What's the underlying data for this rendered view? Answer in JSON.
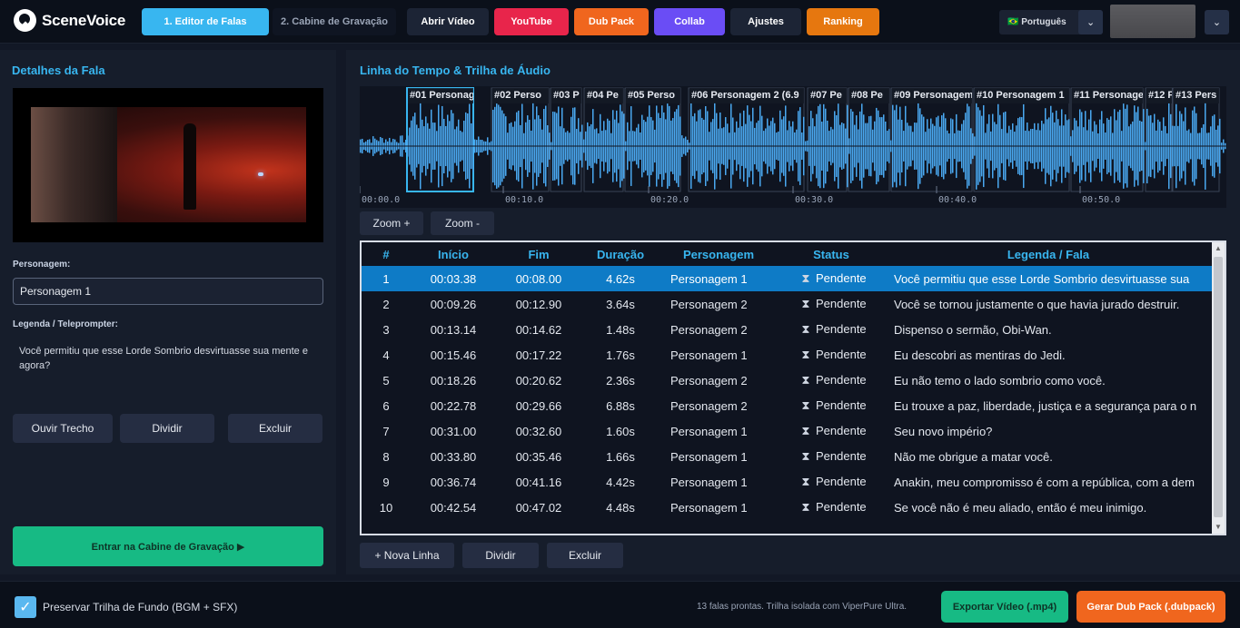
{
  "app": {
    "name": "SceneVoice"
  },
  "nav": {
    "editor": "1. Editor de Falas",
    "booth": "2. Cabine de Gravação",
    "open_video": "Abrir Vídeo",
    "youtube": "YouTube",
    "dubpack": "Dub Pack",
    "collab": "Collab",
    "settings": "Ajustes",
    "ranking": "Ranking",
    "language": "🇧🇷 Português"
  },
  "left": {
    "title": "Detalhes da Fala",
    "character_label": "Personagem:",
    "character_value": "Personagem 1",
    "legend_label": "Legenda / Teleprompter:",
    "legend_value": "Você permitiu que esse Lorde Sombrio desvirtuasse sua mente e agora?",
    "listen": "Ouvir Trecho",
    "split": "Dividir",
    "delete": "Excluir",
    "enter_booth": "Entrar na Cabine de Gravação ▶"
  },
  "timeline": {
    "title": "Linha do Tempo & Trilha de Áudio",
    "segment_labels": [
      "#01 Personagem 1",
      "#02 Perso",
      "#03 P",
      "#04 Pe",
      "#05 Perso",
      "#06 Personagem 2 (6.9",
      "#07 Pe",
      "#08 Pe",
      "#09 Personagem",
      "#10 Personagem 1",
      "#11 Personage",
      "#12 Pe",
      "#13 Pers"
    ],
    "ticks": [
      "00:00.0",
      "00:10.0",
      "00:20.0",
      "00:30.0",
      "00:40.0",
      "00:50.0"
    ],
    "zoom_in": "Zoom +",
    "zoom_out": "Zoom -"
  },
  "table": {
    "headers": [
      "#",
      "Início",
      "Fim",
      "Duração",
      "Personagem",
      "Status",
      "Legenda / Fala"
    ],
    "rows": [
      {
        "n": "1",
        "start": "00:03.38",
        "end": "00:08.00",
        "dur": "4.62s",
        "char": "Personagem 1",
        "status": "Pendente",
        "text": "Você permitiu que esse Lorde Sombrio desvirtuasse sua"
      },
      {
        "n": "2",
        "start": "00:09.26",
        "end": "00:12.90",
        "dur": "3.64s",
        "char": "Personagem 2",
        "status": "Pendente",
        "text": "Você se tornou justamente o que havia jurado destruir."
      },
      {
        "n": "3",
        "start": "00:13.14",
        "end": "00:14.62",
        "dur": "1.48s",
        "char": "Personagem 2",
        "status": "Pendente",
        "text": "Dispenso o sermão, Obi-Wan."
      },
      {
        "n": "4",
        "start": "00:15.46",
        "end": "00:17.22",
        "dur": "1.76s",
        "char": "Personagem 1",
        "status": "Pendente",
        "text": "Eu descobri as mentiras do Jedi."
      },
      {
        "n": "5",
        "start": "00:18.26",
        "end": "00:20.62",
        "dur": "2.36s",
        "char": "Personagem 2",
        "status": "Pendente",
        "text": "Eu não temo o lado sombrio como você."
      },
      {
        "n": "6",
        "start": "00:22.78",
        "end": "00:29.66",
        "dur": "6.88s",
        "char": "Personagem 2",
        "status": "Pendente",
        "text": "Eu trouxe a paz, liberdade, justiça e a segurança para o n"
      },
      {
        "n": "7",
        "start": "00:31.00",
        "end": "00:32.60",
        "dur": "1.60s",
        "char": "Personagem 1",
        "status": "Pendente",
        "text": "Seu novo império?"
      },
      {
        "n": "8",
        "start": "00:33.80",
        "end": "00:35.46",
        "dur": "1.66s",
        "char": "Personagem 1",
        "status": "Pendente",
        "text": "Não me obrigue a matar você."
      },
      {
        "n": "9",
        "start": "00:36.74",
        "end": "00:41.16",
        "dur": "4.42s",
        "char": "Personagem 1",
        "status": "Pendente",
        "text": "Anakin, meu compromisso é com a república, com a dem"
      },
      {
        "n": "10",
        "start": "00:42.54",
        "end": "00:47.02",
        "dur": "4.48s",
        "char": "Personagem 1",
        "status": "Pendente",
        "text": "Se você não é meu aliado, então é meu inimigo."
      }
    ],
    "new_line": "+ Nova Linha",
    "split": "Dividir",
    "delete": "Excluir"
  },
  "footer": {
    "preserve": "Preservar Trilha de Fundo (BGM + SFX)",
    "status": "13 falas prontas. Trilha isolada com ViperPure Ultra.",
    "export": "Exportar Vídeo (.mp4)",
    "dubpack": "Gerar Dub Pack (.dubpack)"
  },
  "colors": {
    "accent": "#38b6f0",
    "selected_row": "#0e7bc6",
    "green": "#17ba84",
    "orange": "#f0661e",
    "youtube": "#e8254b",
    "collab": "#6a4df5",
    "ranking": "#e6770f",
    "waveform": "#4aa8f0"
  }
}
